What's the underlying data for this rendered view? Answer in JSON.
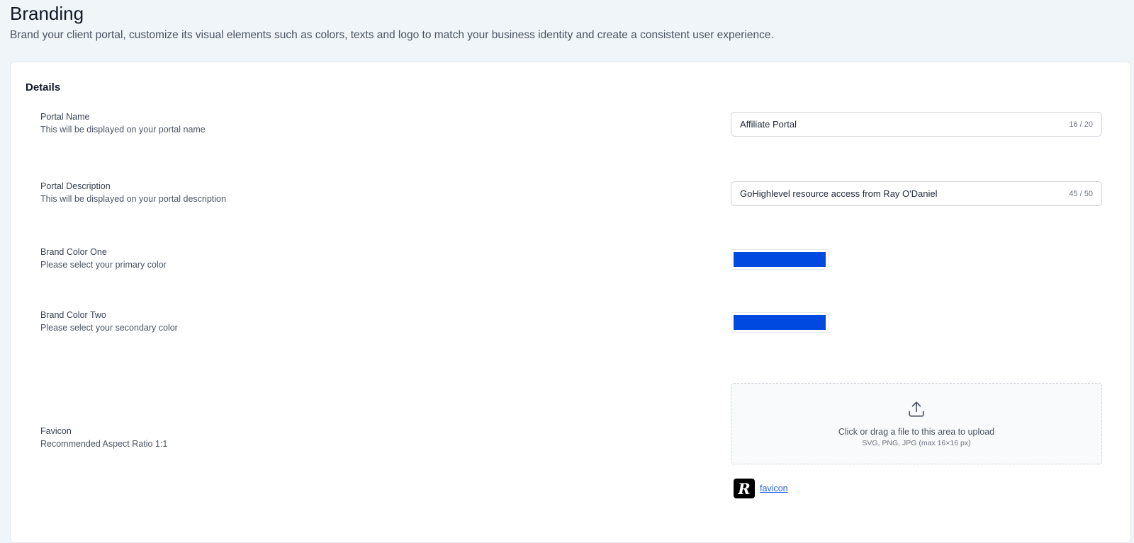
{
  "header": {
    "title": "Branding",
    "subtitle": "Brand your client portal, customize its visual elements such as colors, texts and logo to match your business identity and create a consistent user experience."
  },
  "details": {
    "title": "Details",
    "portal_name": {
      "label": "Portal Name",
      "help": "This will be displayed on your portal name",
      "value": "Affiliate Portal",
      "counter": "16 / 20"
    },
    "portal_description": {
      "label": "Portal Description",
      "help": "This will be displayed on your portal description",
      "value": "GoHighlevel resource access from Ray O'Daniel",
      "counter": "45 / 50"
    },
    "brand_color_one": {
      "label": "Brand Color One",
      "help": "Please select your primary color",
      "color": "#0049e0"
    },
    "brand_color_two": {
      "label": "Brand Color Two",
      "help": "Please select your secondary color",
      "color": "#0049e0"
    },
    "favicon": {
      "label": "Favicon",
      "help": "Recommended Aspect Ratio 1:1",
      "upload_text": "Click or drag a file to this area to upload",
      "upload_hint": "SVG, PNG, JPG (max 16×16 px)",
      "upload_icon": "upload-icon",
      "file_name": "favicon",
      "file_thumb_icon": "favicon-thumbnail"
    }
  }
}
